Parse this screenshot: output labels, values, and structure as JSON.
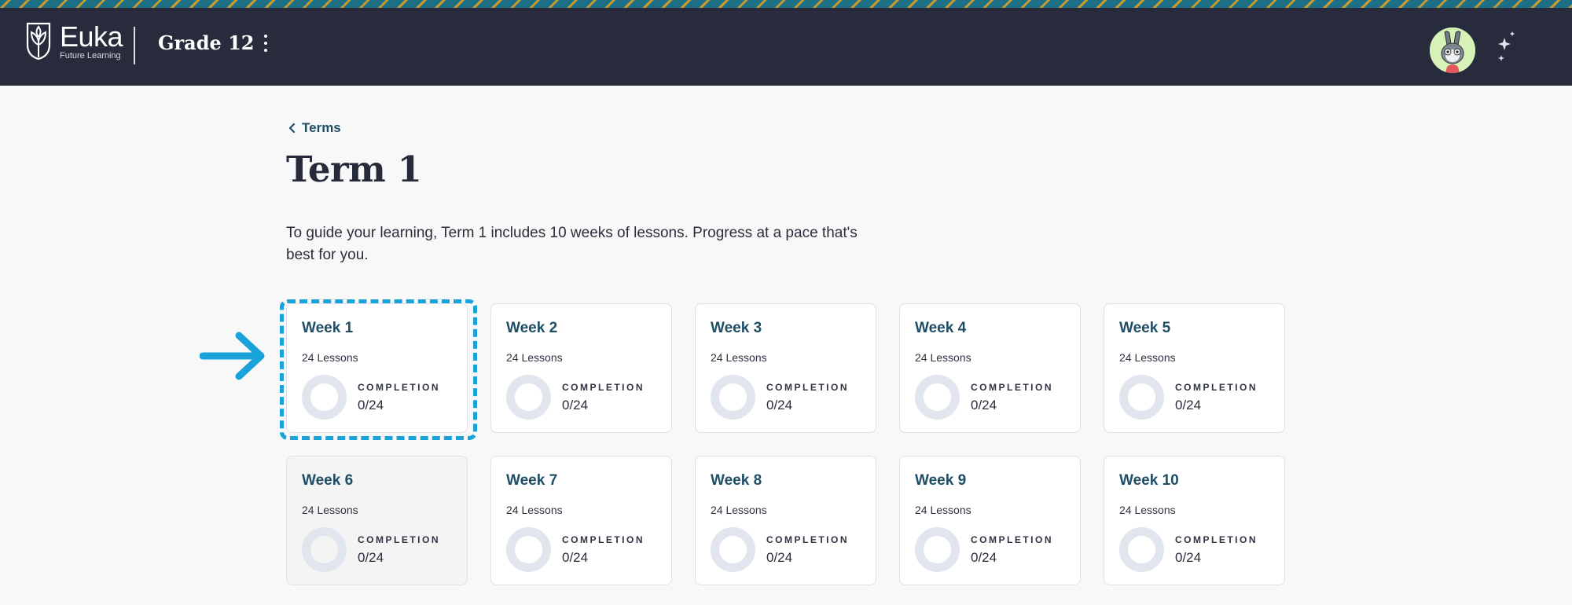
{
  "header": {
    "logo_name": "Euka",
    "logo_tagline": "Future Learning",
    "grade": "Grade 12"
  },
  "breadcrumb": {
    "label": "Terms"
  },
  "page": {
    "title": "Term 1",
    "intro": "To guide your learning, Term 1 includes 10 weeks of lessons. Progress at a pace that's best for you."
  },
  "weeks": [
    {
      "title": "Week 1",
      "lessons": "24 Lessons",
      "completion_label": "COMPLETION",
      "completion": "0/24"
    },
    {
      "title": "Week 2",
      "lessons": "24 Lessons",
      "completion_label": "COMPLETION",
      "completion": "0/24"
    },
    {
      "title": "Week 3",
      "lessons": "24 Lessons",
      "completion_label": "COMPLETION",
      "completion": "0/24"
    },
    {
      "title": "Week 4",
      "lessons": "24 Lessons",
      "completion_label": "COMPLETION",
      "completion": "0/24"
    },
    {
      "title": "Week 5",
      "lessons": "24 Lessons",
      "completion_label": "COMPLETION",
      "completion": "0/24"
    },
    {
      "title": "Week 6",
      "lessons": "24 Lessons",
      "completion_label": "COMPLETION",
      "completion": "0/24"
    },
    {
      "title": "Week 7",
      "lessons": "24 Lessons",
      "completion_label": "COMPLETION",
      "completion": "0/24"
    },
    {
      "title": "Week 8",
      "lessons": "24 Lessons",
      "completion_label": "COMPLETION",
      "completion": "0/24"
    },
    {
      "title": "Week 9",
      "lessons": "24 Lessons",
      "completion_label": "COMPLETION",
      "completion": "0/24"
    },
    {
      "title": "Week 10",
      "lessons": "24 Lessons",
      "completion_label": "COMPLETION",
      "completion": "0/24"
    }
  ],
  "colors": {
    "header_bg": "#282b3c",
    "accent_link": "#1e4d66",
    "highlight": "#1aa3d9",
    "ring": "#e1e6ee"
  },
  "icons": {
    "logo": "euka-shield-logo-icon",
    "menu": "kebab-menu-icon",
    "back": "chevron-left-icon",
    "theme": "moon-stars-icon",
    "pointer": "arrow-right-icon"
  }
}
